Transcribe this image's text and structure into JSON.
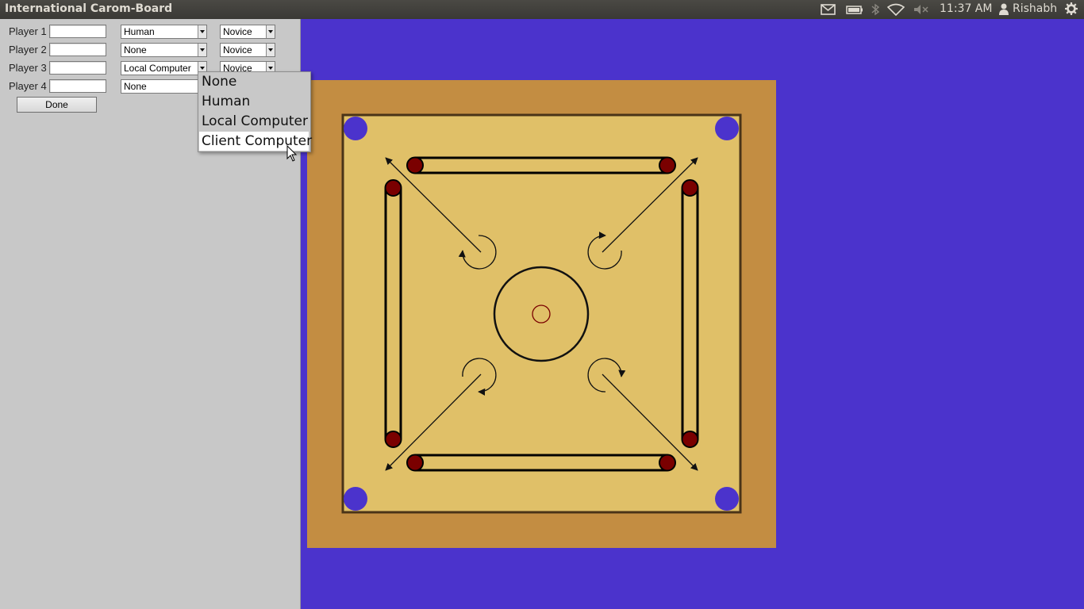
{
  "topbar": {
    "title": "International Carom-Board",
    "time": "11:37 AM",
    "user": "Rishabh",
    "icons": [
      "mail-icon",
      "battery-icon",
      "bluetooth-icon",
      "wifi-icon",
      "volume-muted-icon",
      "user-icon",
      "gear-icon"
    ]
  },
  "players": [
    {
      "label": "Player 1",
      "name": "",
      "type": "Human",
      "level": "Novice"
    },
    {
      "label": "Player 2",
      "name": "",
      "type": "None",
      "level": "Novice"
    },
    {
      "label": "Player 3",
      "name": "",
      "type": "Local Computer",
      "level": "Novice"
    },
    {
      "label": "Player 4",
      "name": "",
      "type": "None",
      "level": ""
    }
  ],
  "done_label": "Done",
  "popup": {
    "options": [
      "None",
      "Human",
      "Local Computer",
      "Client Computer"
    ],
    "highlighted": "Client Computer"
  },
  "colors": {
    "background": "#4b33cc",
    "board_frame": "#c38d42",
    "board_surface": "#e0c068",
    "pocket": "#4b33cc",
    "base_circle": "#7a0000"
  }
}
